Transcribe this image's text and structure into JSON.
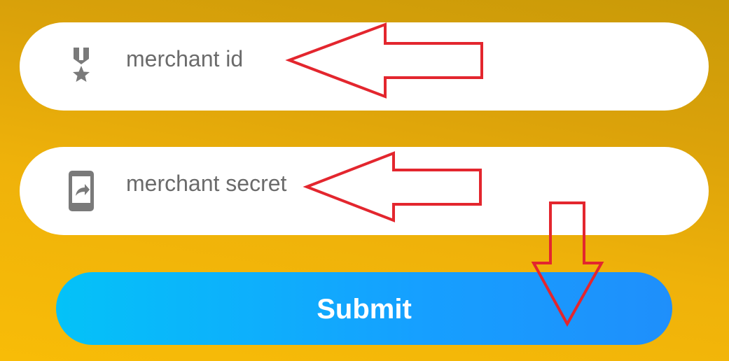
{
  "form": {
    "merchant_id": {
      "placeholder": "merchant id",
      "icon": "medal-icon"
    },
    "merchant_secret": {
      "placeholder": "merchant secret",
      "icon": "phone-share-icon"
    },
    "submit_label": "Submit"
  },
  "annotations": {
    "arrow_color": "#e3262e",
    "items": [
      {
        "points_to": "merchant id field",
        "direction": "left"
      },
      {
        "points_to": "merchant secret field",
        "direction": "left"
      },
      {
        "points_to": "Submit button",
        "direction": "down"
      }
    ]
  },
  "colors": {
    "background_top": "#c99a08",
    "background_bottom": "#f8bc07",
    "button_start": "#04c2f8",
    "button_end": "#1f8ffb",
    "icon": "#7a7a7a",
    "placeholder": "#6b6b6b"
  }
}
